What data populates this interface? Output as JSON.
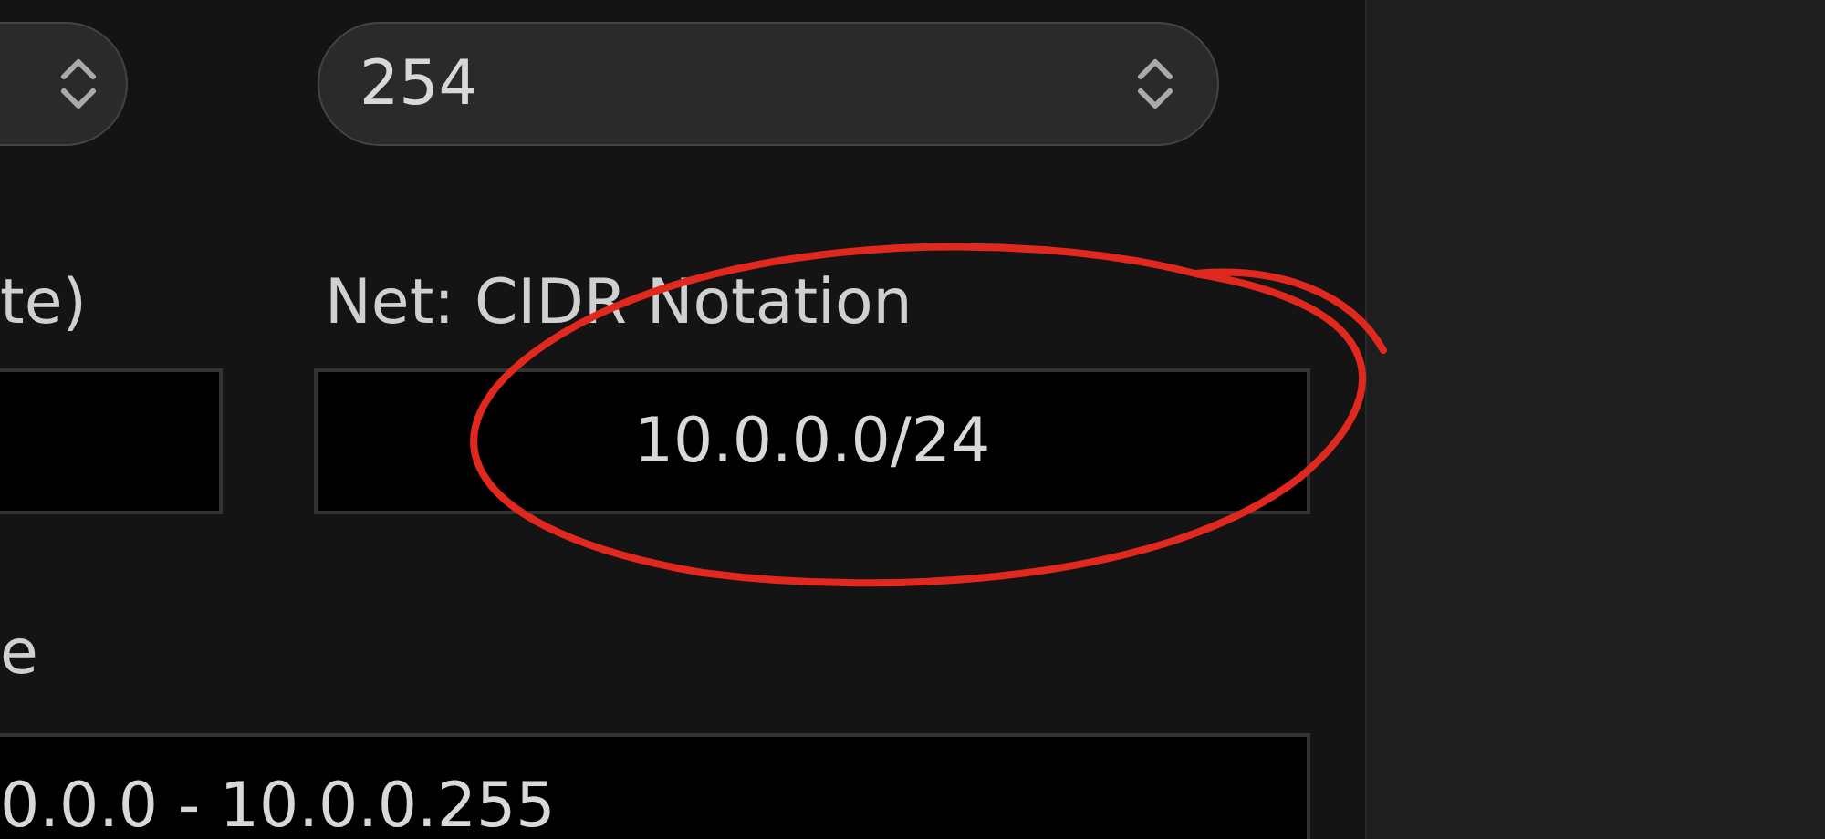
{
  "top_selects": [
    {
      "value": "254"
    }
  ],
  "left_label": "te)",
  "net_label": "Net: CIDR Notation",
  "net_value": "10.0.0.0/24",
  "range_label": "e",
  "range_value": "0.0.0 - 10.0.0.255"
}
